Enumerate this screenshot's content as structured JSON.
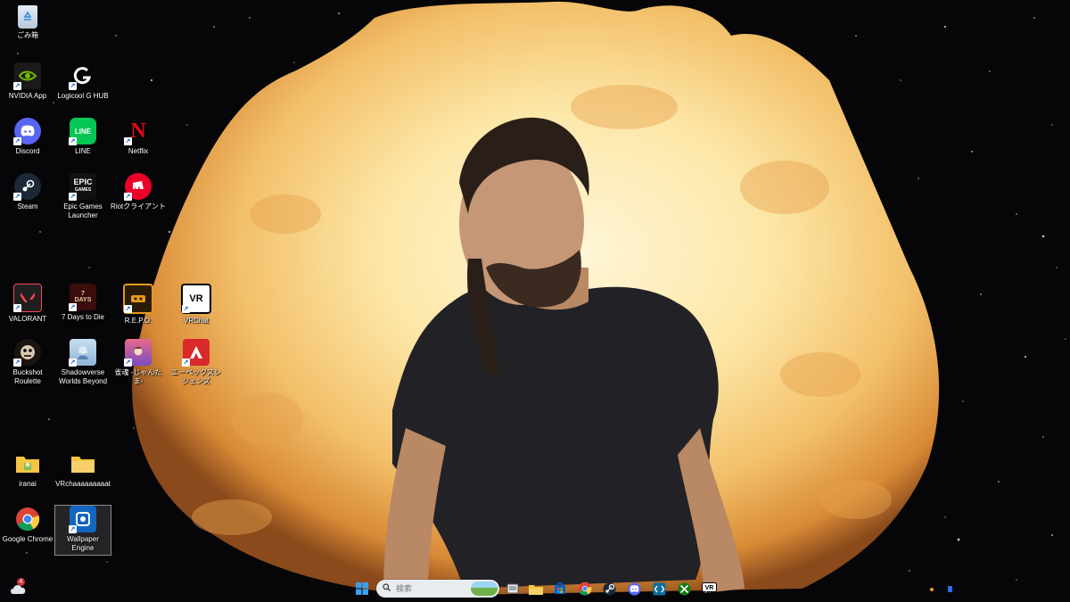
{
  "desktop": {
    "icons": [
      {
        "id": "recycle-bin",
        "label": "ごみ箱"
      },
      {
        "id": "nvidia",
        "label": "NVIDIA App"
      },
      {
        "id": "logicool",
        "label": "Logicool G HUB"
      },
      {
        "id": "discord",
        "label": "Discord"
      },
      {
        "id": "line",
        "label": "LINE"
      },
      {
        "id": "netflix",
        "label": "Netflix"
      },
      {
        "id": "steam",
        "label": "Steam"
      },
      {
        "id": "epic",
        "label": "Epic Games Launcher"
      },
      {
        "id": "riot",
        "label": "Riotクライアント"
      },
      {
        "id": "valorant",
        "label": "VALORANT"
      },
      {
        "id": "7days",
        "label": "7 Days to Die"
      },
      {
        "id": "repo",
        "label": "R.E.P.O."
      },
      {
        "id": "vrchat-app",
        "label": "VRChat"
      },
      {
        "id": "buckshot",
        "label": "Buckshot Roulette"
      },
      {
        "id": "shadowverse",
        "label": "Shadowverse Worlds Beyond"
      },
      {
        "id": "jantama",
        "label": "雀魂 -じゃんたま-"
      },
      {
        "id": "apex",
        "label": "エーペックスレジェンズ"
      },
      {
        "id": "iranai",
        "label": "iranai"
      },
      {
        "id": "vrchat-folder",
        "label": "VRchaaaaaaaaat"
      },
      {
        "id": "chrome",
        "label": "Google Chrome"
      },
      {
        "id": "wallpaper-engine",
        "label": "Wallpaper Engine"
      }
    ]
  },
  "taskbar": {
    "search_placeholder": "検索",
    "weather_badge": "4",
    "pinned": [
      "start-icon",
      "task-view-icon",
      "file-explorer-icon",
      "store-icon",
      "chrome-icon",
      "steam-icon",
      "discord-icon",
      "code-icon",
      "xbox-icon",
      "vrchat-icon"
    ]
  },
  "colors": {
    "taskbar_bg": "transparent",
    "search_bg": "#e9ecef",
    "discord": "#5865f2",
    "line": "#06c755",
    "netflix": "#e50914",
    "riot": "#eb0029",
    "apex": "#da292a",
    "valorant": "#fd4556"
  }
}
